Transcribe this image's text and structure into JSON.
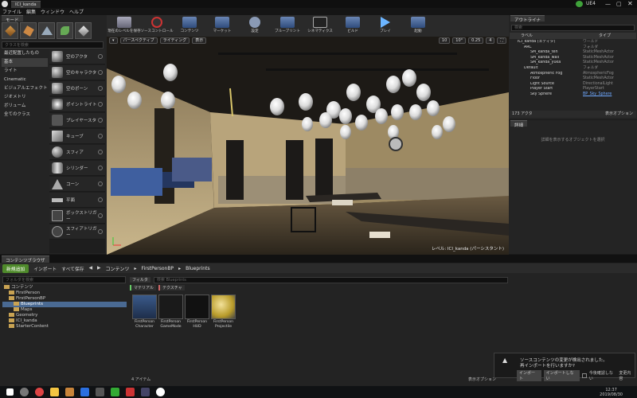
{
  "window": {
    "tab_title": "ICI_kanda",
    "app_badge": "UE4",
    "menus": [
      "ファイル",
      "編集",
      "ウィンドウ",
      "ヘルプ"
    ]
  },
  "modes": {
    "tab_label": "モード",
    "search_placeholder": "クラスを検索",
    "categories": [
      "最近配置したもの",
      "基本",
      "ライト",
      "Cinematic",
      "ビジュアルエフェクト",
      "ジオメトリ",
      "ボリューム",
      "全てのクラス"
    ],
    "selected_category": "基本",
    "actors": [
      "空のアクタ",
      "空のキャラクタ",
      "空のポーン",
      "ポイントライト",
      "プレイヤースタ",
      "キューブ",
      "スフィア",
      "シリンダー",
      "コーン",
      "平面",
      "ボックストリガー",
      "スフィアトリガー"
    ]
  },
  "toolbar": {
    "buttons": [
      "現在のレベルを保存",
      "ソースコントロール",
      "コンテンツ",
      "マーケット",
      "設定",
      "ブループリント",
      "シネマティクス",
      "ビルド",
      "プレイ",
      "起動"
    ]
  },
  "viewport": {
    "perspective": "パースペクティブ",
    "lighting": "ライティング",
    "show": "表示",
    "grid_value": "10",
    "rotation_value": "10°",
    "scale_value": "0.25",
    "camera_speed": "4",
    "level_label": "レベル: ICI_kanda (パーシスタント)"
  },
  "outliner": {
    "tab_label": "アウトライナ",
    "search_placeholder": "検索",
    "col_label": "ラベル",
    "col_type": "タイプ",
    "rows": [
      {
        "name": "ICI_kanda (エディタ)",
        "type": "ワールド"
      },
      {
        "name": "ARC",
        "type": "フォルダ"
      },
      {
        "name": "SM_kanda_ten",
        "type": "StaticMeshActor"
      },
      {
        "name": "SM_kanda_wall",
        "type": "StaticMeshActor"
      },
      {
        "name": "SM_kanda_yuka",
        "type": "StaticMeshActor"
      },
      {
        "name": "Default",
        "type": "フォルダ"
      },
      {
        "name": "Atmospheric Fog",
        "type": "AtmosphericFog"
      },
      {
        "name": "Floor",
        "type": "StaticMeshActor"
      },
      {
        "name": "Light Source",
        "type": "DirectionalLight"
      },
      {
        "name": "Player Start",
        "type": "PlayerStart"
      },
      {
        "name": "Sky Sphere",
        "type": "BP_Sky_Sphere"
      }
    ],
    "actor_count": "173 アクタ",
    "view_options": "表示オプション"
  },
  "details": {
    "tab_label": "詳細",
    "hint": "詳細を表示するオブジェクトを選択"
  },
  "content_browser": {
    "tab_label": "コンテンツブラウザ",
    "add_new": "新規追加",
    "import": "インポート",
    "save_all": "すべて保存",
    "breadcrumbs": [
      "コンテンツ",
      "FirstPersonBP",
      "Blueprints"
    ],
    "folder_search_placeholder": "フォルダを検索",
    "filter_label": "フィルタ",
    "search_placeholder": "検索 Blueprints",
    "tree": [
      {
        "label": "コンテンツ",
        "level": 0
      },
      {
        "label": "FirstPerson",
        "level": 1
      },
      {
        "label": "FirstPersonBP",
        "level": 1
      },
      {
        "label": "Blueprints",
        "level": 2
      },
      {
        "label": "Maps",
        "level": 2
      },
      {
        "label": "Geometry",
        "level": 1
      },
      {
        "label": "ICI_kanda",
        "level": 1
      },
      {
        "label": "StarterContent",
        "level": 1
      }
    ],
    "selected_folder": "Blueprints",
    "filter_chips": [
      "マテリアル",
      "テクスチャ"
    ],
    "assets": [
      "FirstPerson Character",
      "FirstPerson GameMode",
      "FirstPerson HUD",
      "FirstPerson Projectile"
    ],
    "asset_count": "4 アイテム",
    "view_options": "表示オプション"
  },
  "toast": {
    "message_line1": "ソースコンテンツの変更が検出されました。",
    "message_line2": "再インポートを行いますか?",
    "import_btn": "インポート",
    "no_import_btn": "インポートしない",
    "dont_ask": "今後確認しない",
    "settings": "変更内容"
  },
  "taskbar": {
    "time": "12:37",
    "date": "2019/08/30"
  }
}
